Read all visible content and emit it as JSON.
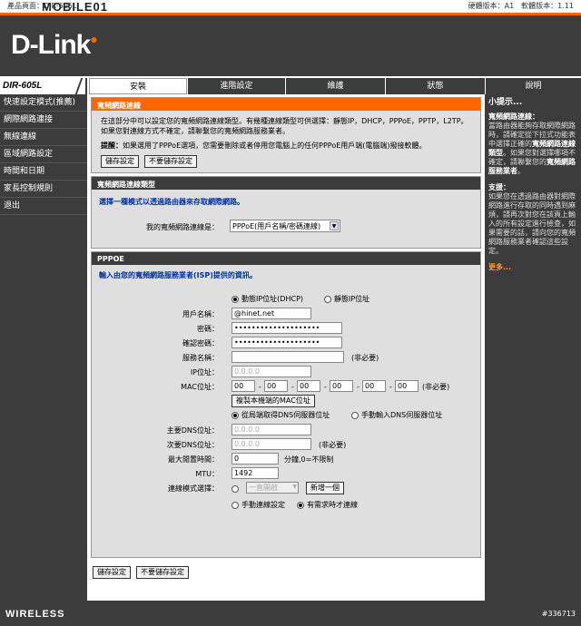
{
  "topbar": {
    "product": "產品頁面：DIR-605L",
    "watermark": "MOBILE01",
    "version": "硬體版本：A1　軟體版本：1.11"
  },
  "logo": "D-Link",
  "model": "DIR-605L",
  "tabs": [
    "安裝",
    "進階設定",
    "維護",
    "狀態",
    "說明"
  ],
  "sidebar": [
    "快速設定模式(推薦)",
    "網際網路連接",
    "無線連線",
    "區域網路設定",
    "時間和日期",
    "家長控制規則",
    "退出"
  ],
  "intro": {
    "title": "寬頻網路連線",
    "text": "在這部分中可以設定您的寬頻網路連線類型。有幾種連線類型可供選擇：靜態IP，DHCP，PPPoE，PPTP，L2TP。如果您對連線方式不確定，請聯繫您的寬頻網路服務業者。",
    "tip_label": "提醒：",
    "tip": "如果選用了PPPoE選項，您需要刪除或者停用您電腦上的任何PPPoE用戶端(電腦端)撥接軟體。",
    "save": "儲存設定",
    "nosave": "不要儲存設定"
  },
  "conn_type": {
    "title": "寬頻網路連線類型",
    "prompt": "選擇一種模式以透過路由器來存取網際網路。",
    "label": "我的寬頻網路連線是：",
    "value": "PPPoE(用戶名稱/密碼連線)"
  },
  "pppoe": {
    "title": "PPPOE",
    "prompt": "輸入由您的寬頻網路服務業者(ISP)提供的資訊。",
    "dynamic_ip": "動態IP位址(DHCP)",
    "static_ip": "靜態IP位址",
    "username_label": "用戶名稱：",
    "username": "@hinet.net",
    "password_label": "密碼：",
    "password": "••••••••••••••••••••",
    "confirm_label": "確認密碼：",
    "confirm": "••••••••••••••••••••",
    "service_label": "服務名稱：",
    "optional": "(非必要)",
    "ip_label": "IP位址：",
    "ip": "0.0.0.0",
    "mac_label": "MAC位址：",
    "mac": [
      "00",
      "00",
      "00",
      "00",
      "00",
      "00"
    ],
    "clone_mac": "複製本機端的MAC位址",
    "dns_auto": "從局端取得DNS伺服器位址",
    "dns_manual": "手動輸入DNS伺服器位址",
    "dns1_label": "主要DNS位址：",
    "dns1": "0.0.0.0",
    "dns2_label": "次要DNS位址：",
    "dns2": "0.0.0.0",
    "idle_label": "最大閒置時間：",
    "idle": "0",
    "idle_unit": "分鐘,0=不限制",
    "mtu_label": "MTU：",
    "mtu": "1492",
    "mode_label": "連線模式選擇：",
    "mode_select": "一直開啟",
    "add_new": "新增一個",
    "manual": "手動連線設定",
    "on_demand": "有需求時才連線",
    "save": "儲存設定",
    "nosave": "不要儲存設定"
  },
  "help": {
    "title": "小提示...",
    "h1": "寬頻網路連線：",
    "p1a": "當路由器能夠存取網際網路時，請確定從下拉式功能表中選擇正確的",
    "p1b": "寬頻網路連線類型",
    "p1c": "。如果您對選擇哪項不確定，請聯繫您的",
    "p1d": "寬頻網路服務業者",
    "p1e": "。",
    "h2": "支援：",
    "p2": "如果您在透過路由器對網際網路進行存取的同時遇到麻煩，請再次對您在該頁上輸入的所有設定進行檢查，如果需要的話，請向您的寬頻網路服務業者確認這些設定。",
    "more": "更多..."
  },
  "footer": {
    "brand": "WIRELESS",
    "id": "#336713"
  }
}
